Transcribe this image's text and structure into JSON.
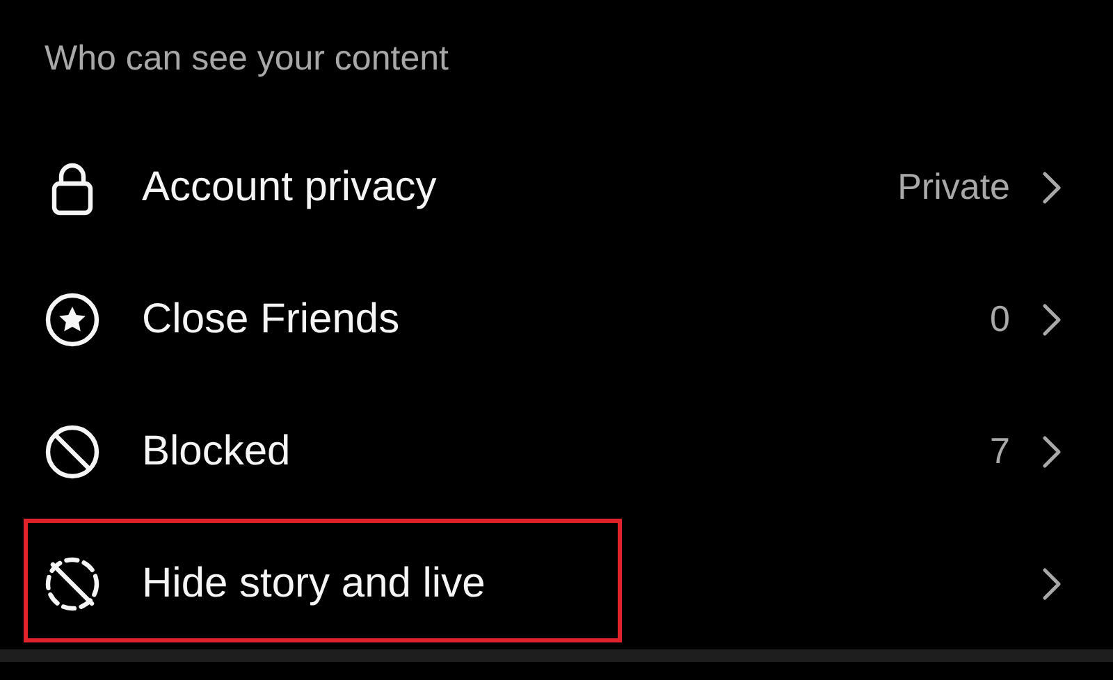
{
  "section_title": "Who can see your content",
  "items": [
    {
      "kind": "lock",
      "label": "Account privacy",
      "value": "Private",
      "highlighted": false
    },
    {
      "kind": "star",
      "label": "Close Friends",
      "value": "0",
      "highlighted": false
    },
    {
      "kind": "blocked",
      "label": "Blocked",
      "value": "7",
      "highlighted": false
    },
    {
      "kind": "hidden",
      "label": "Hide story and live",
      "highlighted": true
    }
  ]
}
